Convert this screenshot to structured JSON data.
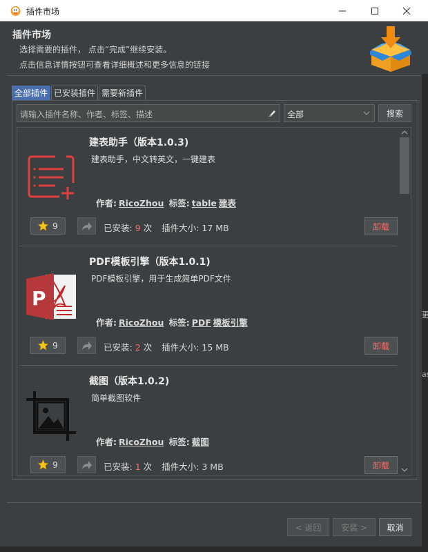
{
  "window": {
    "title": "插件市场"
  },
  "header": {
    "title": "插件市场",
    "line1": "选择需要的插件， 点击“完成”继续安装。",
    "line2": "点击信息详情按钮可查看详细概述和更多信息的链接"
  },
  "tabs": [
    {
      "label": "全部插件",
      "active": true
    },
    {
      "label": "已安装插件",
      "active": false
    },
    {
      "label": "需要新插件",
      "active": false
    }
  ],
  "search": {
    "placeholder": "请输入插件名称、作者、标签、描述",
    "category": "全部",
    "button": "搜索"
  },
  "labels": {
    "author": "作者:",
    "tags": "标签:",
    "installed": "已安装:",
    "times": "次",
    "size": "插件大小:"
  },
  "plugins": [
    {
      "name": "建表助手（版本1.0.3)",
      "description": "建表助手，中文转英文，一键建表",
      "author": "RicoZhou",
      "tags": [
        "table",
        "建表"
      ],
      "stars": "9",
      "installs": "9",
      "size": "17 MB",
      "action": "卸载",
      "icon": "list-add-icon"
    },
    {
      "name": "PDF模板引擎（版本1.0.1)",
      "description": "PDF模板引擎，用于生成简单PDF文件",
      "author": "RicoZhou",
      "tags": [
        "PDF",
        "模板引擎"
      ],
      "stars": "9",
      "installs": "2",
      "size": "15 MB",
      "action": "卸载",
      "icon": "powerpoint-pdf-icon"
    },
    {
      "name": "截图（版本1.0.2)",
      "description": "简单截图软件",
      "author": "RicoZhou",
      "tags": [
        "截图"
      ],
      "stars": "9",
      "installs": "1",
      "size": "3 MB",
      "action": "卸载",
      "icon": "crop-image-icon"
    }
  ],
  "footer": {
    "back": "< 返回",
    "install": "安装 >",
    "cancel": "取消"
  },
  "background_fragments": {
    "a": "更",
    "b": "as"
  },
  "colors": {
    "accent": "#4b6eaf",
    "danger": "#ff6b68",
    "background": "#3c3f41"
  }
}
